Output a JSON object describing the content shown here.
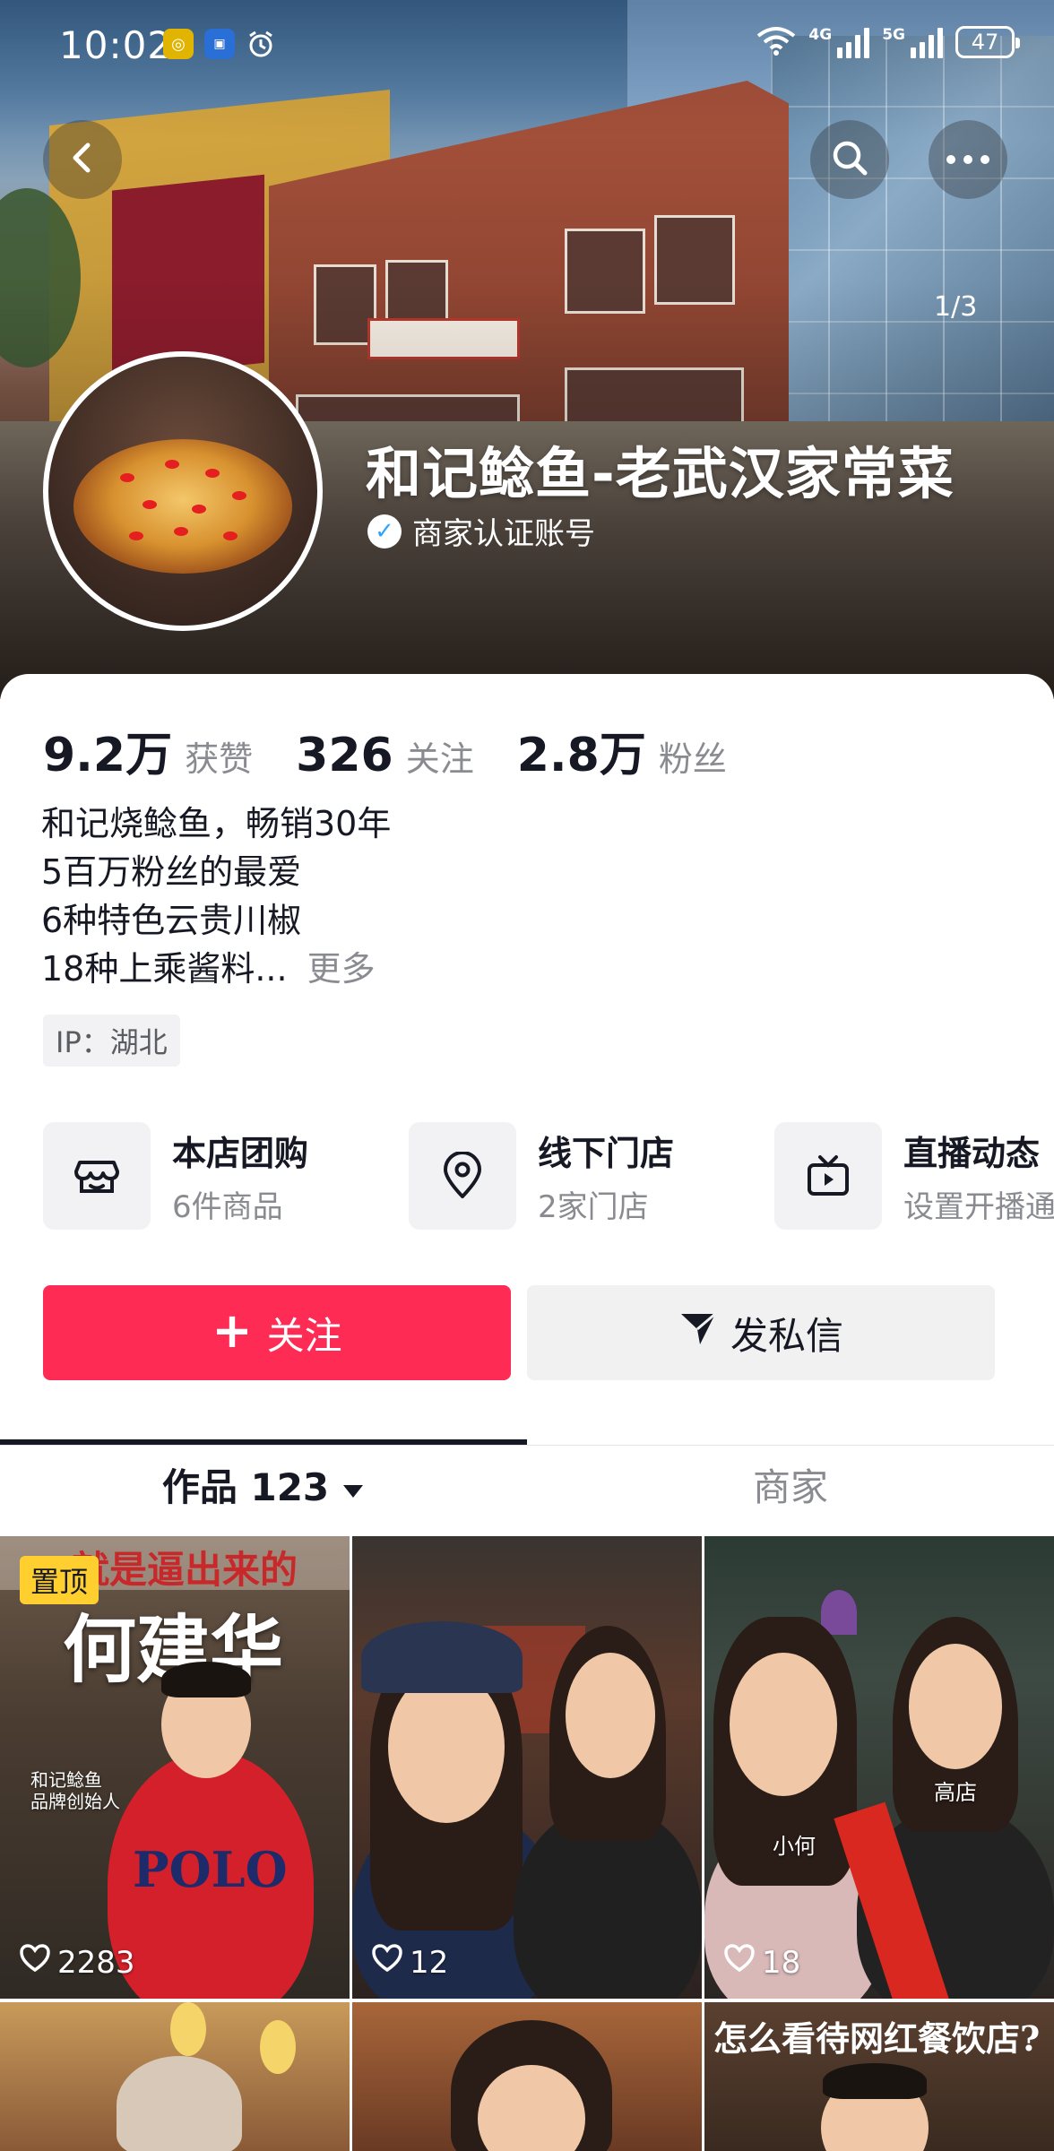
{
  "status_bar": {
    "time": "10:02",
    "net1": "4G",
    "net2": "5G",
    "battery": "47"
  },
  "header": {
    "back_icon": "chevron-left-icon",
    "search_icon": "search-icon",
    "more_icon": "more-dots-icon",
    "cover_indicator": "1/3"
  },
  "profile": {
    "name": "和记鲶鱼-老武汉家常菜",
    "verified_label": "商家认证账号",
    "stats": [
      {
        "value": "9.2万",
        "label": "获赞"
      },
      {
        "value": "326",
        "label": "关注"
      },
      {
        "value": "2.8万",
        "label": "粉丝"
      }
    ],
    "bio_lines": [
      "和记烧鲶鱼，畅销30年",
      "5百万粉丝的最爱",
      "6种特色云贵川椒",
      "18种上乘酱料..."
    ],
    "bio_more": "更多",
    "ip_tag": "IP：湖北"
  },
  "services": [
    {
      "title": "本店团购",
      "subtitle": "6件商品",
      "icon": "store-icon"
    },
    {
      "title": "线下门店",
      "subtitle": "2家门店",
      "icon": "location-pin-icon"
    },
    {
      "title": "直播动态",
      "subtitle": "设置开播通知",
      "icon": "tv-live-icon"
    }
  ],
  "actions": {
    "follow_label": "关注",
    "message_label": "发私信"
  },
  "tabs": {
    "works_label": "作品 123",
    "shop_label": "商家"
  },
  "videos": [
    {
      "pinned": "置顶",
      "likes": "2283",
      "title_overlay": "就是逼出来的",
      "name_overlay": "何建华",
      "caption": "和记鲶鱼\n品牌创始人"
    },
    {
      "likes": "12"
    },
    {
      "likes": "18",
      "caption_a": "小何",
      "caption_b": "高店"
    },
    {},
    {},
    {
      "title_overlay": "怎么看待网红餐饮店?"
    }
  ],
  "colors": {
    "accent": "#fe2c55",
    "pin": "#fecf2e",
    "verify": "#2da5ff"
  }
}
